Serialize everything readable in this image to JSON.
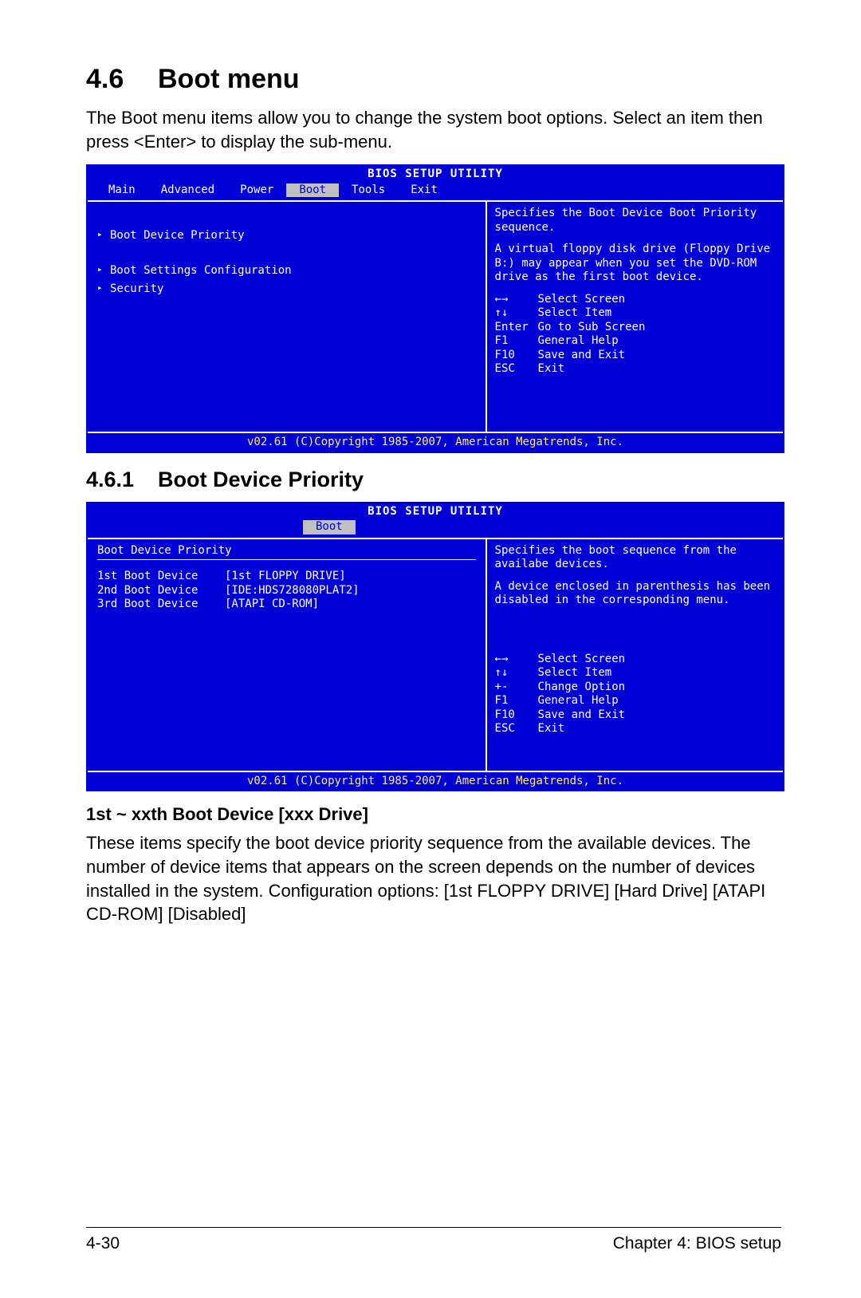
{
  "section": {
    "number": "4.6",
    "title": "Boot menu"
  },
  "intro": "The Boot menu items allow you to change the system boot options. Select an item then press <Enter> to display the sub-menu.",
  "bios1": {
    "title": "BIOS SETUP UTILITY",
    "tabs": [
      "Main",
      "Advanced",
      "Power",
      "Boot",
      "Tools",
      "Exit"
    ],
    "active_tab": "Boot",
    "items": [
      {
        "label": "Boot Device Priority",
        "arrow": true,
        "gap_after": true
      },
      {
        "label": "Boot Settings Configuration",
        "arrow": true
      },
      {
        "label": "Security",
        "arrow": true
      }
    ],
    "side_text1": "Specifies the Boot Device Boot Priority sequence.",
    "side_text2": "A virtual floppy disk drive (Floppy Drive B:) may appear when you set the DVD-ROM drive as the first boot device.",
    "keys": [
      {
        "k": "←→",
        "d": "Select Screen"
      },
      {
        "k": "↑↓",
        "d": "Select Item"
      },
      {
        "k": "Enter",
        "d": "Go to Sub Screen"
      },
      {
        "k": "F1",
        "d": "General Help"
      },
      {
        "k": "F10",
        "d": "Save and Exit"
      },
      {
        "k": "ESC",
        "d": "Exit"
      }
    ],
    "footer": "v02.61 (C)Copyright 1985-2007, American Megatrends, Inc."
  },
  "subsection": {
    "number": "4.6.1",
    "title": "Boot Device Priority"
  },
  "bios2": {
    "title": "BIOS SETUP UTILITY",
    "active_tab": "Boot",
    "section_title": "Boot Device Priority",
    "options": [
      {
        "label": "1st Boot Device",
        "value": "[1st FLOPPY DRIVE]",
        "sel": true
      },
      {
        "label": "2nd Boot Device",
        "value": "[IDE:HDS728080PLAT2]"
      },
      {
        "label": "3rd Boot Device",
        "value": "[ATAPI CD-ROM]"
      }
    ],
    "side_text1": "Specifies the boot sequence from the availabe devices.",
    "side_text2": "A device enclosed in parenthesis has been disabled in the corresponding menu.",
    "keys": [
      {
        "k": "←→",
        "d": "Select Screen"
      },
      {
        "k": "↑↓",
        "d": "Select Item"
      },
      {
        "k": "+-",
        "d": "Change Option"
      },
      {
        "k": "F1",
        "d": "General Help"
      },
      {
        "k": "F10",
        "d": "Save and Exit"
      },
      {
        "k": "ESC",
        "d": "Exit"
      }
    ],
    "footer": "v02.61 (C)Copyright 1985-2007, American Megatrends, Inc."
  },
  "item_heading": "1st ~ xxth Boot Device [xxx Drive]",
  "item_body": "These items specify the boot device priority sequence from the available devices. The number of device items that appears on the screen depends on the number of devices installed in the system. Configuration options: [1st FLOPPY DRIVE] [Hard Drive] [ATAPI CD-ROM] [Disabled]",
  "footer": {
    "left": "4-30",
    "right": "Chapter 4: BIOS setup"
  }
}
